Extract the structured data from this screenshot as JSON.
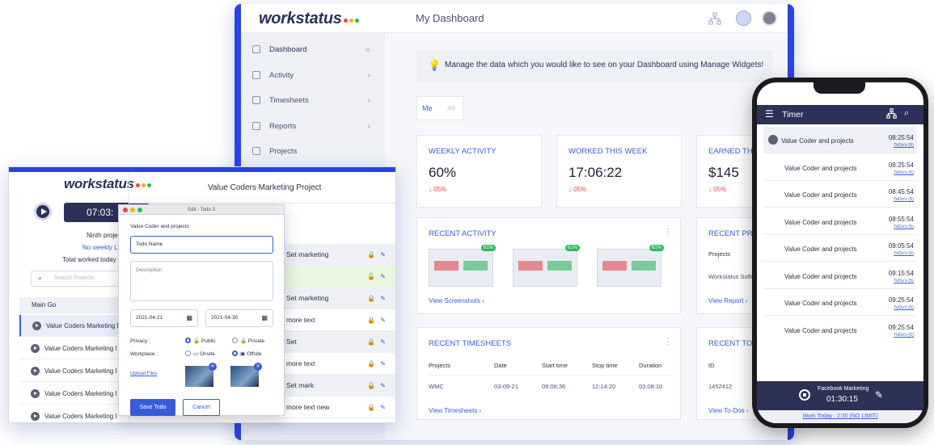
{
  "dashboard": {
    "logo": "workstatus",
    "title": "My Dashboard",
    "sidebar": [
      {
        "label": "Dashboard",
        "chevron": "«"
      },
      {
        "label": "Activity",
        "chevron": "›"
      },
      {
        "label": "Timesheets",
        "chevron": "›"
      },
      {
        "label": "Reports",
        "chevron": "›"
      },
      {
        "label": "Projects",
        "chevron": ""
      }
    ],
    "banner": "Manage the data which you would like to see on your Dashboard using Manage Widgets!",
    "tabs": [
      "Me",
      "All"
    ],
    "stats": [
      {
        "title": "WEEKLY ACTIVITY",
        "value": "60%",
        "delta": "↓ 05%"
      },
      {
        "title": "WORKED THIS WEEK",
        "value": "17:06:22",
        "delta": "↓ 05%"
      },
      {
        "title": "EARNED THIS",
        "value": "$145",
        "delta": "↓ 05%"
      }
    ],
    "recent_activity": {
      "title": "RECENT ACTIVITY",
      "pcts": [
        "61%",
        "61%",
        "61%"
      ],
      "link": "View Screenshots ›",
      "more": "⋮"
    },
    "recent_projects": {
      "title": "RECENT PRO",
      "col": "Projects",
      "row": "Workstatus Softw",
      "link": "View Report ›"
    },
    "recent_timesheets": {
      "title": "RECENT TIMESHEETS",
      "headers": [
        "Projects",
        "Date",
        "Start time",
        "Stop time",
        "Duration"
      ],
      "row": [
        "WMC",
        "03-09-21",
        "09:06:36",
        "12:14:20",
        "03:08:10"
      ],
      "link": "View Timesheets ›",
      "more": "⋮"
    },
    "recent_todos": {
      "title": "RECENT TOD",
      "col": "ID",
      "row": "1452412",
      "link": "View To-Dos ›"
    }
  },
  "desktop": {
    "logo": "workstatus",
    "timer": "07:03:",
    "project_line": "Ninth proje",
    "weekly_link": "No weekly L",
    "total_worked": "Total worked today",
    "search_placeholder": "Search Projects",
    "group": "Main Go",
    "projects": [
      "Value Coders Marketing I",
      "Value Coders Marketing I",
      "Value Coders Marketing I",
      "Value Coders Marketing I",
      "Value Coders Marketing I"
    ],
    "panel_title": "Value Coders Marketing Project",
    "tasks": [
      "Set marketing",
      "",
      "Set marketing",
      "more text",
      "Set",
      "more text",
      "Set mark",
      "more text new"
    ]
  },
  "dialog": {
    "window_title": "Edit - Todo 3",
    "project": "Value Coder and projects",
    "todo_name_placeholder": "Todo Name",
    "description_placeholder": "Description",
    "start_date": "2021-04-21",
    "end_date": "2021-04-30",
    "privacy_label": "Privacy :",
    "privacy_public": "Public",
    "privacy_private": "Private",
    "workplace_label": "Workplace :",
    "workplace_onsite": "Onsite",
    "workplace_offsite": "Offsite",
    "upload": "Upload Files",
    "save": "Save Todo",
    "cancel": "Cancel"
  },
  "phone": {
    "title": "Timer",
    "rows": [
      {
        "name": "Value Coder and projects",
        "time": "08:25:54",
        "todo": "ToDo's (5)"
      },
      {
        "name": "Value Coder and projects",
        "time": "08:25:54",
        "todo": "ToDo's (5)"
      },
      {
        "name": "Value Coder and projects",
        "time": "08:45:54",
        "todo": "ToDo's (5)"
      },
      {
        "name": "Value Coder and projects",
        "time": "08:55:54",
        "todo": "ToDo's (5)"
      },
      {
        "name": "Value Coder and projects",
        "time": "09:05:54",
        "todo": "ToDo's (5)"
      },
      {
        "name": "Value Coder and projects",
        "time": "09:15:54",
        "todo": "ToDo's (5)"
      },
      {
        "name": "Value Coder and projects",
        "time": "09:25:54",
        "todo": "ToDo's (5)"
      },
      {
        "name": "Value Coder and projects",
        "time": "09:25:54",
        "todo": "ToDo's (5)"
      }
    ],
    "current_project": "Facebook Marketing",
    "current_timer": "01:30:15",
    "footer": "Work Today : 2:30 (NO LIMIT)"
  },
  "colors": {
    "accent": "#3a5bd9",
    "frame": "#2a44e0",
    "phone_bar": "#2b3157"
  }
}
